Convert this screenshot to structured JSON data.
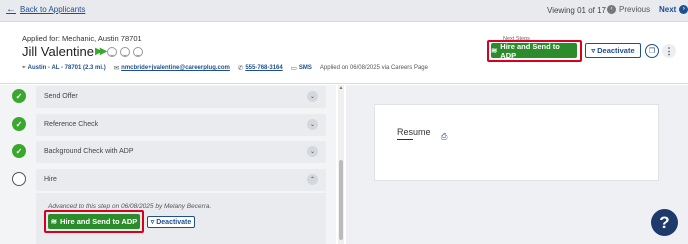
{
  "nav": {
    "back_label": "Back to Applicants",
    "viewing": "Viewing 01 of 17",
    "previous": "Previous",
    "next": "Next"
  },
  "candidate": {
    "applied_for": "Applied for: Mechanic, Austin 78701",
    "name": "Jill Valentine",
    "location": "Austin - AL - 78701 (2.3 mi.)",
    "email": "nmcbride+jvalentine@careerplug.com",
    "phone": "555-768-3164",
    "sms": "SMS",
    "applied_on": "Applied on 06/08/2025 via Careers Page"
  },
  "actions": {
    "next_steps_label": "Next Steps",
    "hire_send": "Hire and Send to ADP",
    "deactivate": "Deactivate"
  },
  "workflow": {
    "steps": [
      {
        "label": "Send Offer",
        "done": true
      },
      {
        "label": "Reference Check",
        "done": true
      },
      {
        "label": "Background Check with ADP",
        "done": true
      },
      {
        "label": "Hire",
        "done": false
      }
    ],
    "hire_note": "Advanced to this step on 06/08/2025 by Melany Becerra.",
    "hire_send": "Hire and Send to ADP",
    "deactivate": "Deactivate"
  },
  "resume": {
    "title": "Resume"
  },
  "help": "?",
  "colors": {
    "primary": "#1d4f91",
    "success": "#2c8c2c",
    "highlight": "#d9001b"
  }
}
